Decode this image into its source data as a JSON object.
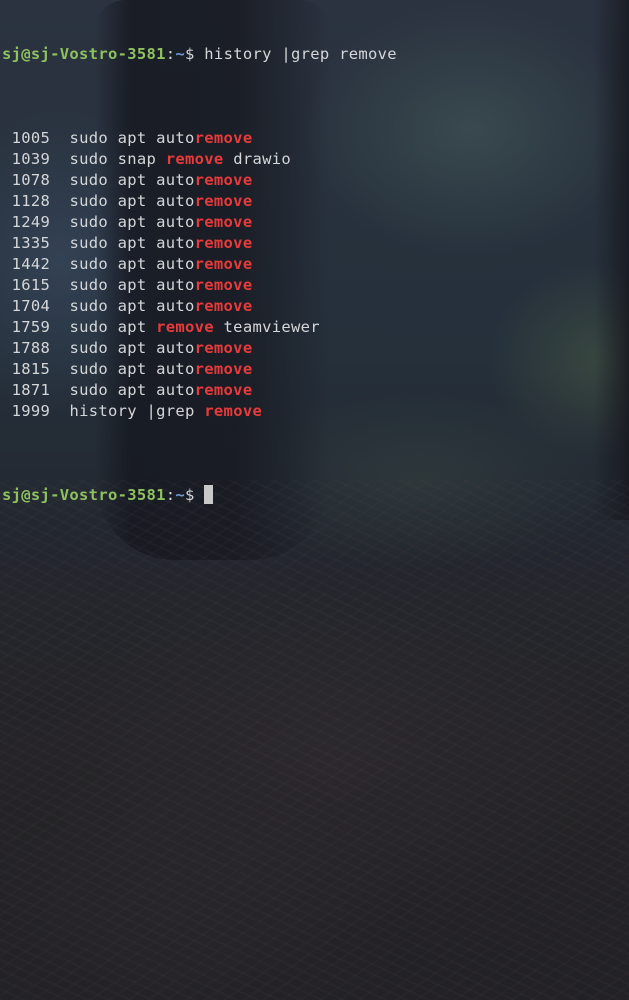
{
  "prompt": {
    "user_host": "sj@sj-Vostro-3581",
    "separator": ":",
    "cwd": "~",
    "symbol": "$"
  },
  "command": " history |grep remove",
  "history_lines": [
    {
      "num": "1005",
      "before": "sudo apt auto",
      "match": "remove",
      "after": ""
    },
    {
      "num": "1039",
      "before": "sudo snap ",
      "match": "remove",
      "after": " drawio"
    },
    {
      "num": "1078",
      "before": "sudo apt auto",
      "match": "remove",
      "after": ""
    },
    {
      "num": "1128",
      "before": "sudo apt auto",
      "match": "remove",
      "after": ""
    },
    {
      "num": "1249",
      "before": "sudo apt auto",
      "match": "remove",
      "after": ""
    },
    {
      "num": "1335",
      "before": "sudo apt auto",
      "match": "remove",
      "after": ""
    },
    {
      "num": "1442",
      "before": "sudo apt auto",
      "match": "remove",
      "after": ""
    },
    {
      "num": "1615",
      "before": "sudo apt auto",
      "match": "remove",
      "after": ""
    },
    {
      "num": "1704",
      "before": "sudo apt auto",
      "match": "remove",
      "after": ""
    },
    {
      "num": "1759",
      "before": "sudo apt ",
      "match": "remove",
      "after": " teamviewer"
    },
    {
      "num": "1788",
      "before": "sudo apt auto",
      "match": "remove",
      "after": ""
    },
    {
      "num": "1815",
      "before": "sudo apt auto",
      "match": "remove",
      "after": ""
    },
    {
      "num": "1871",
      "before": "sudo apt auto",
      "match": "remove",
      "after": ""
    },
    {
      "num": "1999",
      "before": "history |grep ",
      "match": "remove",
      "after": ""
    }
  ],
  "colors": {
    "prompt_user": "#8ec15f",
    "prompt_path": "#6c9bd6",
    "grep_match": "#e83a3a",
    "text": "#d4d6d8"
  }
}
